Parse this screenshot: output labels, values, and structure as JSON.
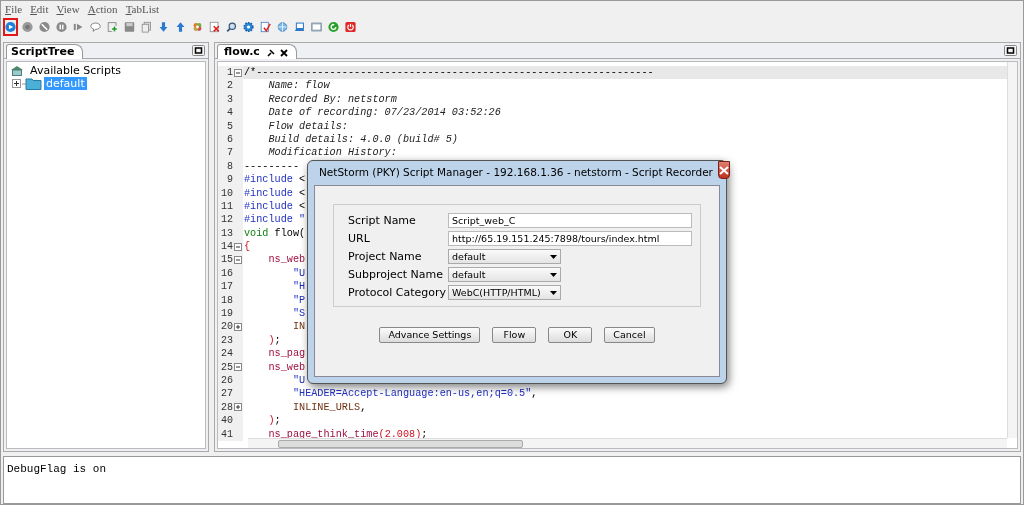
{
  "menu": [
    {
      "label": "File"
    },
    {
      "label": "Edit"
    },
    {
      "label": "View"
    },
    {
      "label": "Action"
    },
    {
      "label": "TabList"
    }
  ],
  "toolbar": [
    {
      "kind": "play",
      "selected": true
    },
    {
      "kind": "record",
      "selected": false
    },
    {
      "kind": "block",
      "selected": false
    },
    {
      "kind": "pause",
      "selected": false
    },
    {
      "kind": "step",
      "selected": false
    },
    {
      "kind": "comment",
      "selected": false
    },
    {
      "kind": "add",
      "selected": false
    },
    {
      "kind": "save",
      "selected": false
    },
    {
      "kind": "copy",
      "selected": false
    },
    {
      "kind": "down",
      "selected": false
    },
    {
      "kind": "up",
      "selected": false
    },
    {
      "kind": "flower",
      "selected": false
    },
    {
      "kind": "delete",
      "selected": false
    },
    {
      "kind": "search",
      "selected": false
    },
    {
      "kind": "gear",
      "selected": false
    },
    {
      "kind": "check",
      "selected": false
    },
    {
      "kind": "globe",
      "selected": false
    },
    {
      "kind": "laptop",
      "selected": false
    },
    {
      "kind": "window",
      "selected": false
    },
    {
      "kind": "refresh",
      "selected": false
    },
    {
      "kind": "power",
      "selected": false
    }
  ],
  "script_tree": {
    "tab": "ScriptTree",
    "root": {
      "label": "Available Scripts",
      "children": [
        {
          "label": "default",
          "selected": true,
          "expanded": false
        }
      ]
    }
  },
  "editor": {
    "tab": "flow.c",
    "lines": [
      {
        "number": "1",
        "expanded": true,
        "current": true,
        "segments": [
          {
            "kind": "plain",
            "text": "/*-----------------------------------------------------------------"
          }
        ]
      },
      {
        "number": "2",
        "current": false,
        "segments": [
          {
            "kind": "comment",
            "text": "    Name: flow"
          }
        ]
      },
      {
        "number": "3",
        "current": false,
        "segments": [
          {
            "kind": "comment",
            "text": "    Recorded By: netstorm"
          }
        ]
      },
      {
        "number": "4",
        "current": false,
        "segments": [
          {
            "kind": "comment",
            "text": "    Date of recording: 07/23/2014 03:52:26"
          }
        ]
      },
      {
        "number": "5",
        "current": false,
        "segments": [
          {
            "kind": "comment",
            "text": "    Flow details:"
          }
        ]
      },
      {
        "number": "6",
        "current": false,
        "segments": [
          {
            "kind": "comment",
            "text": "    Build details: 4.0.0 (build# 5)"
          }
        ]
      },
      {
        "number": "7",
        "current": false,
        "segments": [
          {
            "kind": "comment",
            "text": "    Modification History:"
          }
        ]
      },
      {
        "number": "8",
        "current": false,
        "segments": [
          {
            "kind": "plain",
            "text": "---------"
          }
        ]
      },
      {
        "number": "9",
        "current": false,
        "segments": [
          {
            "kind": "directive",
            "text": "#include"
          },
          {
            "kind": "plain",
            "text": " <"
          }
        ]
      },
      {
        "number": "10",
        "current": false,
        "segments": [
          {
            "kind": "directive",
            "text": "#include"
          },
          {
            "kind": "plain",
            "text": " <"
          }
        ]
      },
      {
        "number": "11",
        "current": false,
        "segments": [
          {
            "kind": "directive",
            "text": "#include"
          },
          {
            "kind": "plain",
            "text": " <"
          }
        ]
      },
      {
        "number": "12",
        "current": false,
        "segments": [
          {
            "kind": "directive",
            "text": "#include"
          },
          {
            "kind": "string",
            "text": " \""
          }
        ]
      },
      {
        "number": "13",
        "current": false,
        "segments": [
          {
            "kind": "type",
            "text": "void"
          },
          {
            "kind": "plain",
            "text": " flow("
          }
        ]
      },
      {
        "number": "14",
        "expanded": true,
        "current": false,
        "segments": [
          {
            "kind": "brace",
            "text": "{"
          }
        ]
      },
      {
        "number": "15",
        "expanded": true,
        "current": false,
        "segments": [
          {
            "kind": "func",
            "text": "    ns_web"
          }
        ]
      },
      {
        "number": "16",
        "current": false,
        "segments": [
          {
            "kind": "string",
            "text": "        \"U"
          }
        ]
      },
      {
        "number": "17",
        "current": false,
        "segments": [
          {
            "kind": "string",
            "text": "        \"H"
          }
        ]
      },
      {
        "number": "18",
        "current": false,
        "segments": [
          {
            "kind": "string",
            "text": "        \"P"
          }
        ]
      },
      {
        "number": "19",
        "current": false,
        "segments": [
          {
            "kind": "string",
            "text": "        \"S"
          }
        ]
      },
      {
        "number": "20",
        "expanded": false,
        "current": false,
        "segments": [
          {
            "kind": "constant",
            "text": "        IN"
          }
        ]
      },
      {
        "number": "23",
        "current": false,
        "segments": [
          {
            "kind": "brace",
            "text": "    )"
          },
          {
            "kind": "plain",
            "text": ";"
          }
        ]
      },
      {
        "number": "24",
        "current": false,
        "segments": [
          {
            "kind": "func",
            "text": "    ns_pag"
          }
        ]
      },
      {
        "number": "25",
        "expanded": true,
        "current": false,
        "segments": [
          {
            "kind": "func",
            "text": "    ns_web"
          }
        ]
      },
      {
        "number": "26",
        "current": false,
        "segments": [
          {
            "kind": "string",
            "text": "        \"U"
          }
        ]
      },
      {
        "number": "27",
        "current": false,
        "segments": [
          {
            "kind": "string",
            "text": "        \"HEADER=Accept-Language:en-us,en;q=0.5\""
          },
          {
            "kind": "plain",
            "text": ","
          }
        ]
      },
      {
        "number": "28",
        "expanded": false,
        "current": false,
        "segments": [
          {
            "kind": "constant",
            "text": "        INLINE_URLS"
          },
          {
            "kind": "plain",
            "text": ","
          }
        ]
      },
      {
        "number": "40",
        "current": false,
        "segments": [
          {
            "kind": "brace",
            "text": "    )"
          },
          {
            "kind": "plain",
            "text": ";"
          }
        ]
      },
      {
        "number": "41",
        "current": false,
        "segments": [
          {
            "kind": "func",
            "text": "    ns_page_think_time"
          },
          {
            "kind": "brace",
            "text": "("
          },
          {
            "kind": "number",
            "text": "2.008"
          },
          {
            "kind": "brace",
            "text": ")"
          },
          {
            "kind": "plain",
            "text": ";"
          }
        ]
      }
    ]
  },
  "dialog": {
    "title": "NetStorm (PKY) Script Manager - 192.168.1.36 - netstorm - Script Recorder",
    "fields": [
      {
        "kind": "text",
        "label": "Script Name",
        "value": "Script_web_C"
      },
      {
        "kind": "text",
        "label": "URL",
        "value": "http://65.19.151.245:7898/tours/index.html"
      },
      {
        "kind": "select",
        "label": "Project Name",
        "value": "default"
      },
      {
        "kind": "select",
        "label": "Subproject Name",
        "value": "default"
      },
      {
        "kind": "select",
        "label": "Protocol Category",
        "value": "WebC(HTTP/HTML)"
      }
    ],
    "buttons": [
      "Advance Settings",
      "Flow",
      "OK",
      "Cancel"
    ]
  },
  "console": {
    "text": "DebugFlag is on"
  }
}
